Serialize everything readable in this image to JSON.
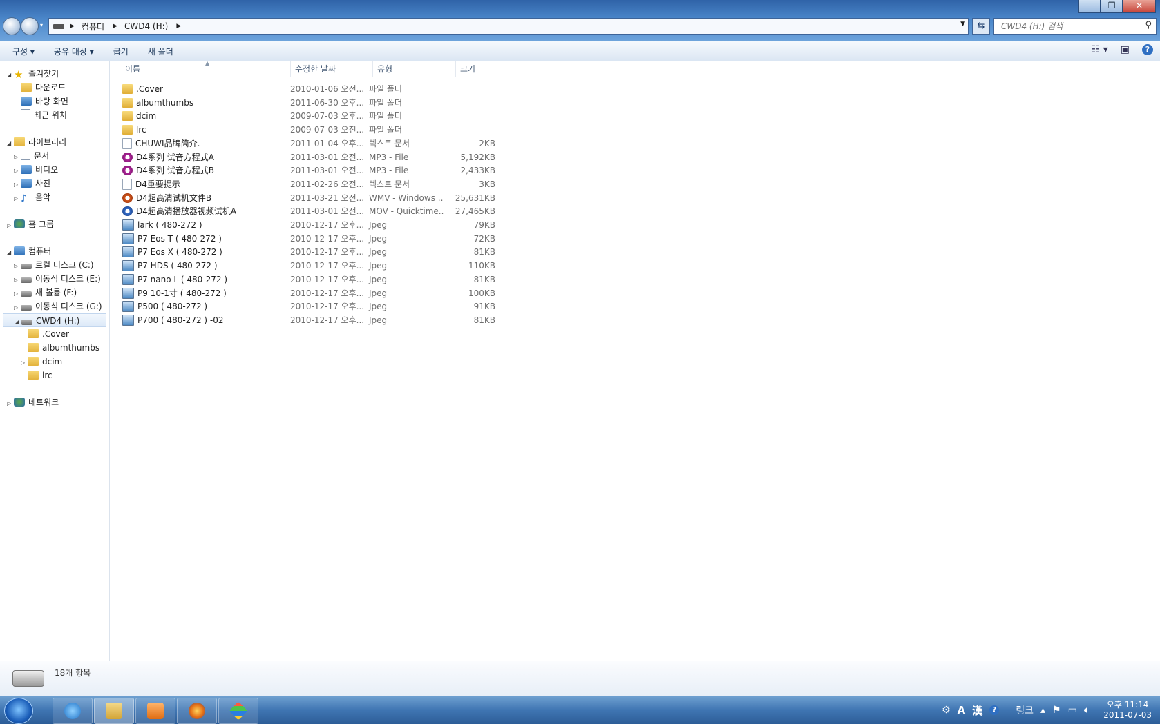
{
  "window": {
    "minimize_icon": "minimize-icon",
    "maximize_icon": "restore-icon",
    "close_icon": "close-icon"
  },
  "address": {
    "crumbs": [
      "컴퓨터",
      "CWD4 (H:)"
    ]
  },
  "search": {
    "placeholder": "CWD4 (H:) 검색"
  },
  "toolbar": {
    "organize": "구성 ▾",
    "share": "공유 대상 ▾",
    "burn": "굽기",
    "new_folder": "새 폴더"
  },
  "nav": {
    "favorites": "즐겨찾기",
    "downloads": "다운로드",
    "desktop": "바탕 화면",
    "recent": "최근 위치",
    "libraries": "라이브러리",
    "documents": "문서",
    "videos": "비디오",
    "pictures": "사진",
    "music": "음악",
    "homegroup": "홈 그룹",
    "computer": "컴퓨터",
    "local_c": "로컬 디스크 (C:)",
    "removable_e": "이동식 디스크 (E:)",
    "volume_f": "새 볼륨 (F:)",
    "removable_g": "이동식 디스크 (G:)",
    "cwd4": "CWD4 (H:)",
    "sub_cover": ".Cover",
    "sub_albumthumbs": "albumthumbs",
    "sub_dcim": "dcim",
    "sub_lrc": "lrc",
    "network": "네트워크"
  },
  "columns": {
    "name": "이름",
    "date": "수정한 날짜",
    "type": "유형",
    "size": "크기"
  },
  "files": [
    {
      "name": ".Cover",
      "date": "2010-01-06 오전...",
      "type": "파일 폴더",
      "size": "",
      "icon": "folder"
    },
    {
      "name": "albumthumbs",
      "date": "2011-06-30 오후...",
      "type": "파일 폴더",
      "size": "",
      "icon": "folder"
    },
    {
      "name": "dcim",
      "date": "2009-07-03 오후...",
      "type": "파일 폴더",
      "size": "",
      "icon": "folder"
    },
    {
      "name": "lrc",
      "date": "2009-07-03 오전...",
      "type": "파일 폴더",
      "size": "",
      "icon": "folder"
    },
    {
      "name": "CHUWI品牌简介.",
      "date": "2011-01-04 오후...",
      "type": "텍스트 문서",
      "size": "2KB",
      "icon": "txt"
    },
    {
      "name": "D4系列 试音方程式A",
      "date": "2011-03-01 오전...",
      "type": "MP3 - File",
      "size": "5,192KB",
      "icon": "mp3"
    },
    {
      "name": "D4系列 试音方程式B",
      "date": "2011-03-01 오전...",
      "type": "MP3 - File",
      "size": "2,433KB",
      "icon": "mp3"
    },
    {
      "name": "D4重要提示",
      "date": "2011-02-26 오전...",
      "type": "텍스트 문서",
      "size": "3KB",
      "icon": "txt"
    },
    {
      "name": "D4超高清试机文件B",
      "date": "2011-03-21 오전...",
      "type": "WMV - Windows ...",
      "size": "25,631KB",
      "icon": "wmv"
    },
    {
      "name": "D4超高清播放器视频试机A",
      "date": "2011-03-01 오전...",
      "type": "MOV - Quicktime...",
      "size": "27,465KB",
      "icon": "mov"
    },
    {
      "name": "lark ( 480-272 )",
      "date": "2010-12-17 오후...",
      "type": "Jpeg",
      "size": "79KB",
      "icon": "jpg"
    },
    {
      "name": "P7 Eos T ( 480-272 )",
      "date": "2010-12-17 오후...",
      "type": "Jpeg",
      "size": "72KB",
      "icon": "jpg"
    },
    {
      "name": "P7 Eos X ( 480-272 )",
      "date": "2010-12-17 오후...",
      "type": "Jpeg",
      "size": "81KB",
      "icon": "jpg"
    },
    {
      "name": "P7 HDS ( 480-272 )",
      "date": "2010-12-17 오후...",
      "type": "Jpeg",
      "size": "110KB",
      "icon": "jpg"
    },
    {
      "name": "P7 nano L ( 480-272 )",
      "date": "2010-12-17 오후...",
      "type": "Jpeg",
      "size": "81KB",
      "icon": "jpg"
    },
    {
      "name": "P9 10-1寸 ( 480-272 )",
      "date": "2010-12-17 오후...",
      "type": "Jpeg",
      "size": "100KB",
      "icon": "jpg"
    },
    {
      "name": "P500 ( 480-272 )",
      "date": "2010-12-17 오후...",
      "type": "Jpeg",
      "size": "91KB",
      "icon": "jpg"
    },
    {
      "name": "P700 ( 480-272 ) -02",
      "date": "2010-12-17 오후...",
      "type": "Jpeg",
      "size": "81KB",
      "icon": "jpg"
    }
  ],
  "details": {
    "count": "18개 항목"
  },
  "taskbar": {
    "tray_links": "링크",
    "lang_a": "A",
    "lang_han": "漢",
    "time": "오후 11:14",
    "date": "2011-07-03"
  }
}
